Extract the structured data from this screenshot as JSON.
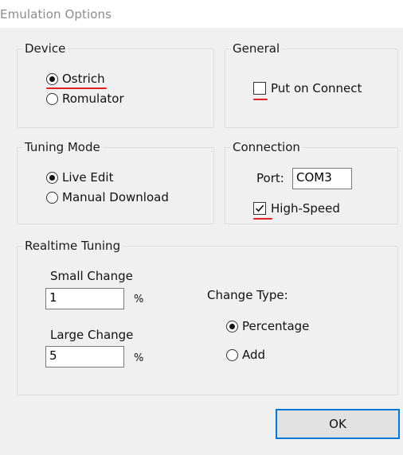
{
  "window": {
    "title": "Emulation Options"
  },
  "device": {
    "legend": "Device",
    "options": [
      {
        "label": "Ostrich",
        "selected": true
      },
      {
        "label": "Romulator",
        "selected": false
      }
    ]
  },
  "general": {
    "legend": "General",
    "put_on_connect": {
      "label": "Put on Connect",
      "checked": false
    }
  },
  "tuning_mode": {
    "legend": "Tuning Mode",
    "options": [
      {
        "label": "Live Edit",
        "selected": true
      },
      {
        "label": "Manual Download",
        "selected": false
      }
    ]
  },
  "connection": {
    "legend": "Connection",
    "port_label": "Port:",
    "port_value": "COM3",
    "high_speed": {
      "label": "High-Speed",
      "checked": true
    }
  },
  "realtime_tuning": {
    "legend": "Realtime Tuning",
    "small_change_label": "Small Change",
    "small_change_value": "1",
    "small_unit": "%",
    "large_change_label": "Large Change",
    "large_change_value": "5",
    "large_unit": "%",
    "change_type_label": "Change Type:",
    "change_type_options": [
      {
        "label": "Percentage",
        "selected": true
      },
      {
        "label": "Add",
        "selected": false
      }
    ]
  },
  "buttons": {
    "ok_label": "OK"
  },
  "annotations": {
    "underline_color": "#e02020"
  },
  "colors": {
    "focus_border": "#0078d7",
    "dialog_bg": "#f0f0f0"
  }
}
